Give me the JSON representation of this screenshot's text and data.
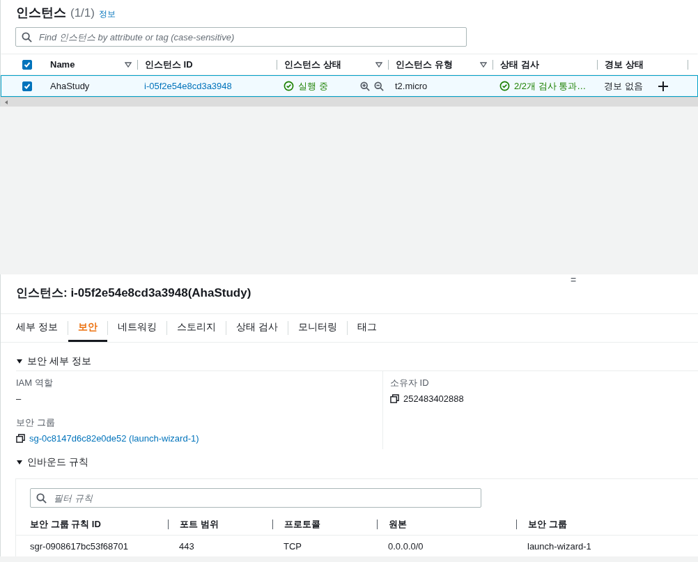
{
  "instances": {
    "title": "인스턴스",
    "count": "(1/1)",
    "info_link": "정보",
    "search": {
      "placeholder": "Find 인스턴스 by attribute or tag (case-sensitive)"
    },
    "select_all": {
      "checked": true
    },
    "columns": [
      {
        "label": "Name",
        "sortable": true
      },
      {
        "label": "인스턴스 ID",
        "sortable": false
      },
      {
        "label": "인스턴스 상태",
        "sortable": true
      },
      {
        "label": "인스턴스 유형",
        "sortable": true
      },
      {
        "label": "상태 검사",
        "sortable": false
      },
      {
        "label": "경보 상태",
        "sortable": false
      }
    ],
    "rows": [
      {
        "selected": true,
        "name": "AhaStudy",
        "instance_id": "i-05f2e54e8cd3a3948",
        "state": "실행 중",
        "type": "t2.micro",
        "status_check": "2/2개 검사 통과…",
        "alarm": "경보 없음"
      }
    ]
  },
  "detail": {
    "title": "인스턴스: i-05f2e54e8cd3a3948(AhaStudy)",
    "resize_handle": "=",
    "tabs": [
      {
        "label": "세부 정보",
        "selected": false
      },
      {
        "label": "보안",
        "selected": true
      },
      {
        "label": "네트워킹",
        "selected": false
      },
      {
        "label": "스토리지",
        "selected": false
      },
      {
        "label": "상태 검사",
        "selected": false
      },
      {
        "label": "모니터링",
        "selected": false
      },
      {
        "label": "태그",
        "selected": false
      }
    ],
    "security": {
      "title": "보안 세부 정보",
      "expanded": true,
      "fields": [
        {
          "label": "IAM 역할",
          "value": "–",
          "kind": "text"
        },
        {
          "label": "소유자 ID",
          "value": "252483402888",
          "kind": "copy"
        },
        {
          "label": "보안 그룹",
          "value": "sg-0c8147d6c82e0de52 (launch-wizard-1)",
          "kind": "link"
        }
      ]
    },
    "inbound": {
      "title": "인바운드 규칙",
      "expanded": true,
      "filter": {
        "placeholder": "필터 규칙"
      },
      "columns": [
        "보안 그룹 규칙 ID",
        "포트 범위",
        "프로토콜",
        "원본",
        "보안 그룹"
      ],
      "rows": [
        [
          "sgr-0908617bc53f68701",
          "443",
          "TCP",
          "0.0.0.0/0",
          "launch-wizard-1"
        ]
      ]
    }
  }
}
